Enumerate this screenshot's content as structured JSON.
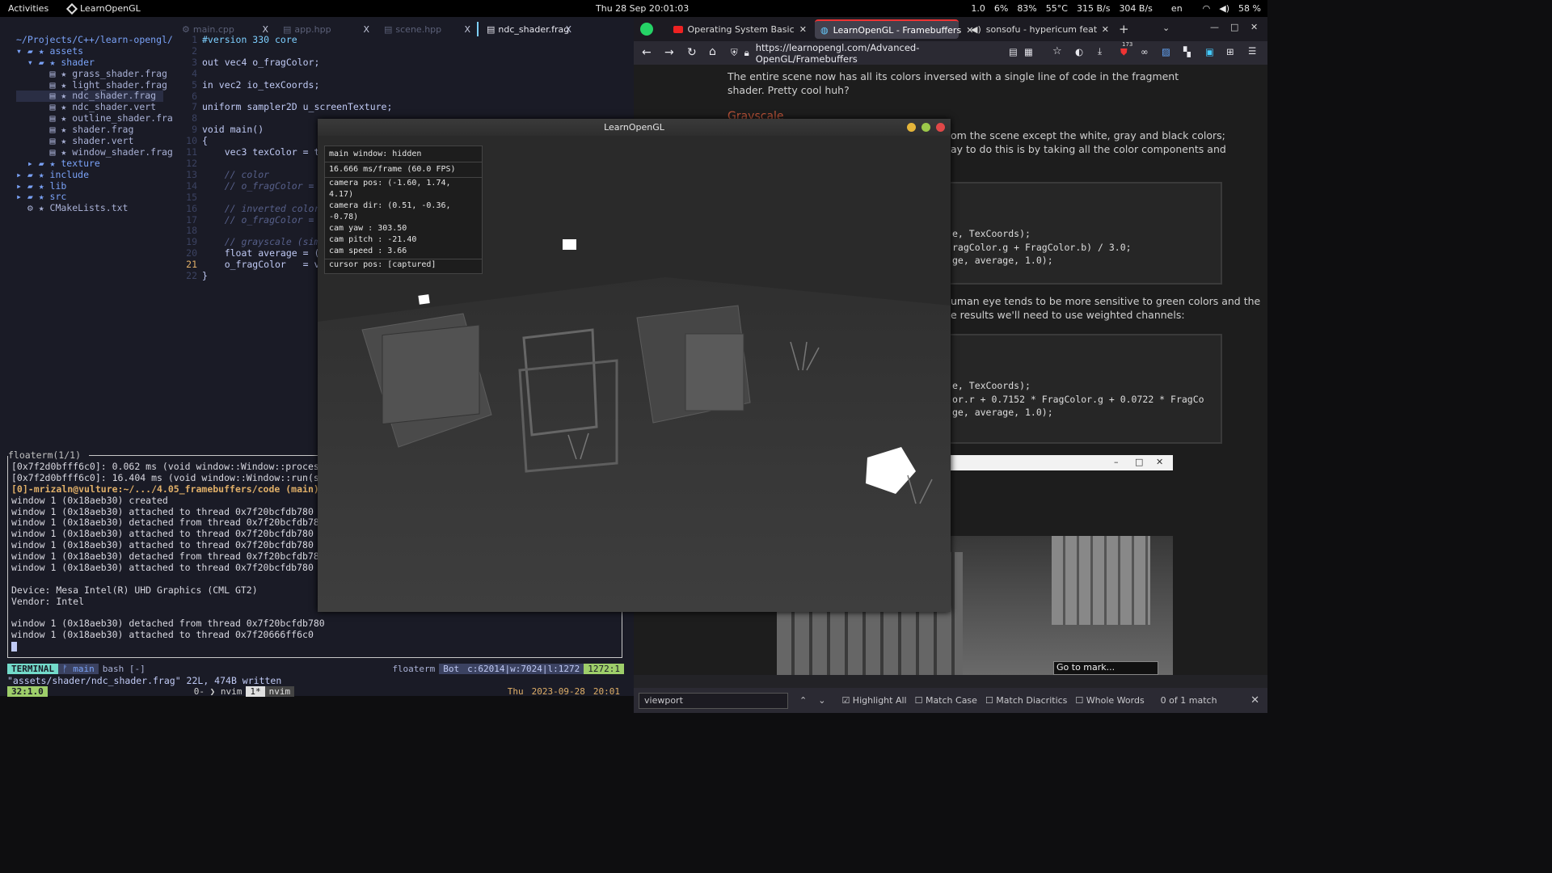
{
  "topbar": {
    "activities": "Activities",
    "app_name": "LearnOpenGL",
    "clock": "Thu 28 Sep  20:01:03",
    "stats": [
      "1.0",
      "6%",
      "83%",
      "55°C",
      "315 B/s",
      "304 B/s",
      "en",
      "58 %"
    ]
  },
  "editor": {
    "tabs": [
      {
        "label": "main.cpp",
        "close": "X"
      },
      {
        "label": "app.hpp",
        "close": "X"
      },
      {
        "label": "scene.hpp",
        "close": "X"
      },
      {
        "label": "ndc_shader.frag",
        "close": "X"
      }
    ],
    "tree": [
      "~/Projects/C++/learn-opengl/",
      "▾ ▰ ★ assets",
      "  ▾ ▰ ★ shader",
      "      ▤ ★ grass_shader.frag",
      "      ▤ ★ light_shader.frag",
      "      ▤ ★ ndc_shader.frag",
      "      ▤ ★ ndc_shader.vert",
      "      ▤ ★ outline_shader.fra",
      "      ▤ ★ shader.frag",
      "      ▤ ★ shader.vert",
      "      ▤ ★ window_shader.frag",
      "  ▸ ▰ ★ texture",
      "▸ ▰ ★ include",
      "▸ ▰ ★ lib",
      "▸ ▰ ★ src",
      "  ⚙ ★ CMakeLists.txt"
    ],
    "code_lines": [
      {
        "n": "1",
        "t": "#version 330 core"
      },
      {
        "n": "2",
        "t": ""
      },
      {
        "n": "3",
        "t": "out vec4 o_fragColor;"
      },
      {
        "n": "4",
        "t": ""
      },
      {
        "n": "5",
        "t": "in vec2 io_texCoords;"
      },
      {
        "n": "6",
        "t": ""
      },
      {
        "n": "7",
        "t": "uniform sampler2D u_screenTexture;"
      },
      {
        "n": "8",
        "t": ""
      },
      {
        "n": "9",
        "t": "void main()"
      },
      {
        "n": "10",
        "t": "{"
      },
      {
        "n": "11",
        "t": "    vec3 texColor = te"
      },
      {
        "n": "12",
        "t": ""
      },
      {
        "n": "13",
        "t": "    // color"
      },
      {
        "n": "14",
        "t": "    // o_fragColor = t"
      },
      {
        "n": "15",
        "t": ""
      },
      {
        "n": "16",
        "t": "    // inverted color"
      },
      {
        "n": "17",
        "t": "    // o_fragColor = v"
      },
      {
        "n": "18",
        "t": ""
      },
      {
        "n": "19",
        "t": "    // grayscale (simp"
      },
      {
        "n": "20",
        "t": "    float average = (t"
      },
      {
        "n": "21",
        "t": "    o_fragColor   = ve"
      },
      {
        "n": "22",
        "t": "}"
      }
    ],
    "floaterm_title": "floaterm(1/1)",
    "terminal_lines": [
      "[0x7f2d0bfff6c0]: 0.062 ms (void window::Window::processQu",
      "[0x7f2d0bfff6c0]: 16.404 ms (void window::Window::run(std:",
      "[0]-mrizaln@vulture:~/.../4.05_framebuffers/code (main)$ .",
      "window 1 (0x18aeb30) created",
      "window 1 (0x18aeb30) attached to thread 0x7f20bcfdb780",
      "window 1 (0x18aeb30) detached from thread 0x7f20bcfdb780",
      "window 1 (0x18aeb30) attached to thread 0x7f20bcfdb780",
      "window 1 (0x18aeb30) attached to thread 0x7f20bcfdb780",
      "window 1 (0x18aeb30) detached from thread 0x7f20bcfdb780",
      "window 1 (0x18aeb30) attached to thread 0x7f20bcfdb780",
      "",
      "Device: Mesa Intel(R) UHD Graphics (CML GT2)",
      "Vendor: Intel",
      "",
      "window 1 (0x18aeb30) detached from thread 0x7f20bcfdb780",
      "window 1 (0x18aeb30) attached to thread 0x7f20666ff6c0"
    ],
    "status": {
      "mode": "TERMINAL",
      "branch": "main",
      "shell": "bash [-]",
      "plugin": "floaterm",
      "pos": "Bot",
      "stats": "c:62014|w:7024|l:1272",
      "cursor": "1272:1"
    },
    "message": "\"assets/shader/ndc_shader.frag\" 22L, 474B written",
    "tmux": {
      "left": "32:1.0",
      "windows": [
        "0- ❯ nvim",
        "1*",
        "nvim"
      ],
      "day": "Thu",
      "date": "2023-09-28",
      "time": "20:01"
    }
  },
  "browser": {
    "tabs": [
      {
        "label": "Operating System Basics - Yo"
      },
      {
        "label": "LearnOpenGL - Framebuffers"
      },
      {
        "label": "sonsofu - hypericum feat. pia"
      }
    ],
    "url": "https://learnopengl.com/Advanced-OpenGL/Framebuffers",
    "ext_badge": "173",
    "page": {
      "para1": "The entire scene now has all its colors inversed with a single line of code in the fragment shader. Pretty cool huh?",
      "heading": "Grayscale",
      "para2a": "om the scene except the white, gray and black colors;",
      "para2b": "ay to do this is by taking all the color components and",
      "code1": [
        "e, TexCoords);",
        "ragColor.g + FragColor.b) / 3.0;",
        "ge, average, 1.0);"
      ],
      "para3a": "uman eye tends to be more sensitive to green colors and the",
      "para3b": "e results we'll need to use weighted channels:",
      "code2": [
        "e, TexCoords);",
        "or.r + 0.7152 * FragColor.g + 0.0722 * FragCo",
        "ge, average, 1.0);"
      ],
      "goto_mark": "Go to mark..."
    },
    "findbar": {
      "query": "viewport",
      "highlight_all": "Highlight All",
      "match_case": "Match Case",
      "match_diacritics": "Match Diacritics",
      "whole_words": "Whole Words",
      "result": "0 of 1 match"
    }
  },
  "glwindow": {
    "title": "LearnOpenGL",
    "overlay": {
      "main_window": "main window: hidden",
      "frame": "16.666 ms/frame (60.0 FPS)",
      "cam_pos": "camera pos: (-1.60, 1.74, 4.17)",
      "cam_dir": "camera dir: (0.51, -0.36, -0.78)",
      "cam_yaw": "cam yaw   : 303.50",
      "cam_pitch": "cam pitch : -21.40",
      "cam_speed": "cam speed : 3.66",
      "cursor": "cursor pos: [captured]"
    }
  },
  "colors": {
    "accent": "#7aa2f7",
    "status_green": "#9ece6a",
    "firefox_red": "#e33"
  }
}
